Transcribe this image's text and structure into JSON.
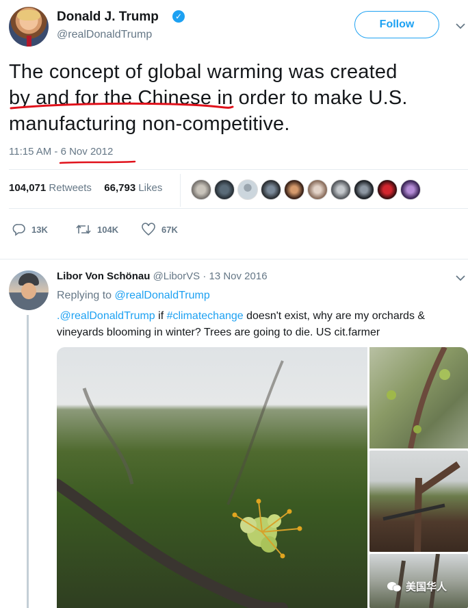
{
  "tweet": {
    "author_name": "Donald J. Trump",
    "handle": "@realDonaldTrump",
    "follow_label": "Follow",
    "text_line1": "The concept of global warming was created",
    "text_line2": "by and for the Chinese in order to make U.S.",
    "text_line3": "manufacturing non-competitive.",
    "timestamp": "11:15 AM - 6 Nov 2012",
    "retweets_count": "104,071",
    "retweets_label": "Retweets",
    "likes_count": "66,793",
    "likes_label": "Likes",
    "actions": {
      "replies": "13K",
      "retweets": "104K",
      "likes": "67K"
    }
  },
  "reply": {
    "author_name": "Libor Von Schönau",
    "handle_date": "@LiborVS · 13 Nov 2016",
    "replying_prefix": "Replying to",
    "replying_to": "@realDonaldTrump",
    "mention": ".@realDonaldTrump",
    "text_a": " if ",
    "hashtag": "#climatechange",
    "text_b": " doesn't exist, why are my orchards &",
    "text_line2": "vineyards blooming in winter? Trees are going to die. US cit.farmer"
  },
  "watermark": {
    "label": "美国华人"
  },
  "colors": {
    "accent": "#1da1f2",
    "muted": "#657786",
    "annotation_red": "#e0101a"
  },
  "icons": [
    "verified-icon",
    "chevron-down-icon",
    "reply-icon",
    "retweet-icon",
    "heart-icon",
    "wechat-icon"
  ]
}
